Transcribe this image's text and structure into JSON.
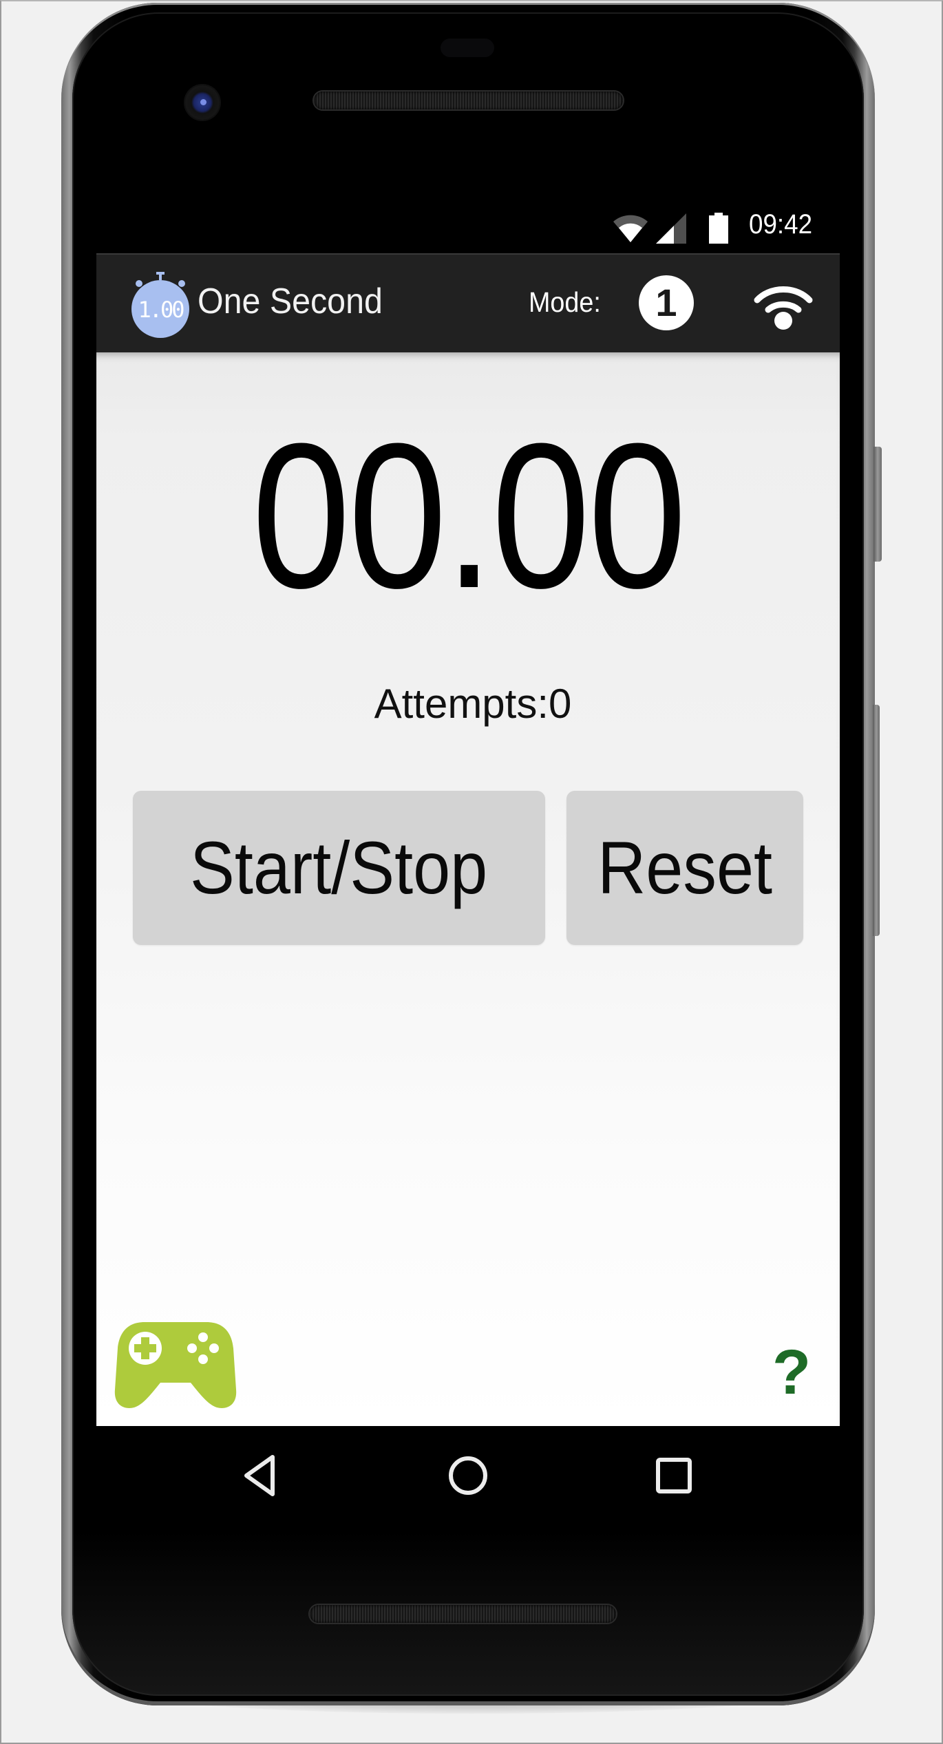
{
  "status_bar": {
    "time": "09:42",
    "icons": [
      "wifi-icon",
      "cell-signal-icon",
      "battery-icon"
    ]
  },
  "app_bar": {
    "app_icon": "stopwatch-icon",
    "app_icon_text": "1.00",
    "title": "One Second",
    "mode_label": "Mode:",
    "mode_value": "1",
    "broadcast_icon": "broadcast-icon"
  },
  "main": {
    "timer_value": "00.00",
    "attempts_text": "Attempts:0",
    "start_stop_label": "Start/Stop",
    "reset_label": "Reset",
    "games_icon": "gamepad-icon",
    "help_label": "?"
  },
  "nav_bar": {
    "buttons": [
      "back",
      "home",
      "recents"
    ]
  },
  "colors": {
    "app_bar_bg": "#212121",
    "app_icon": "#a8bff0",
    "button_bg": "#d3d3d3",
    "gamepad": "#aecb3c",
    "help": "#1e6b27"
  }
}
